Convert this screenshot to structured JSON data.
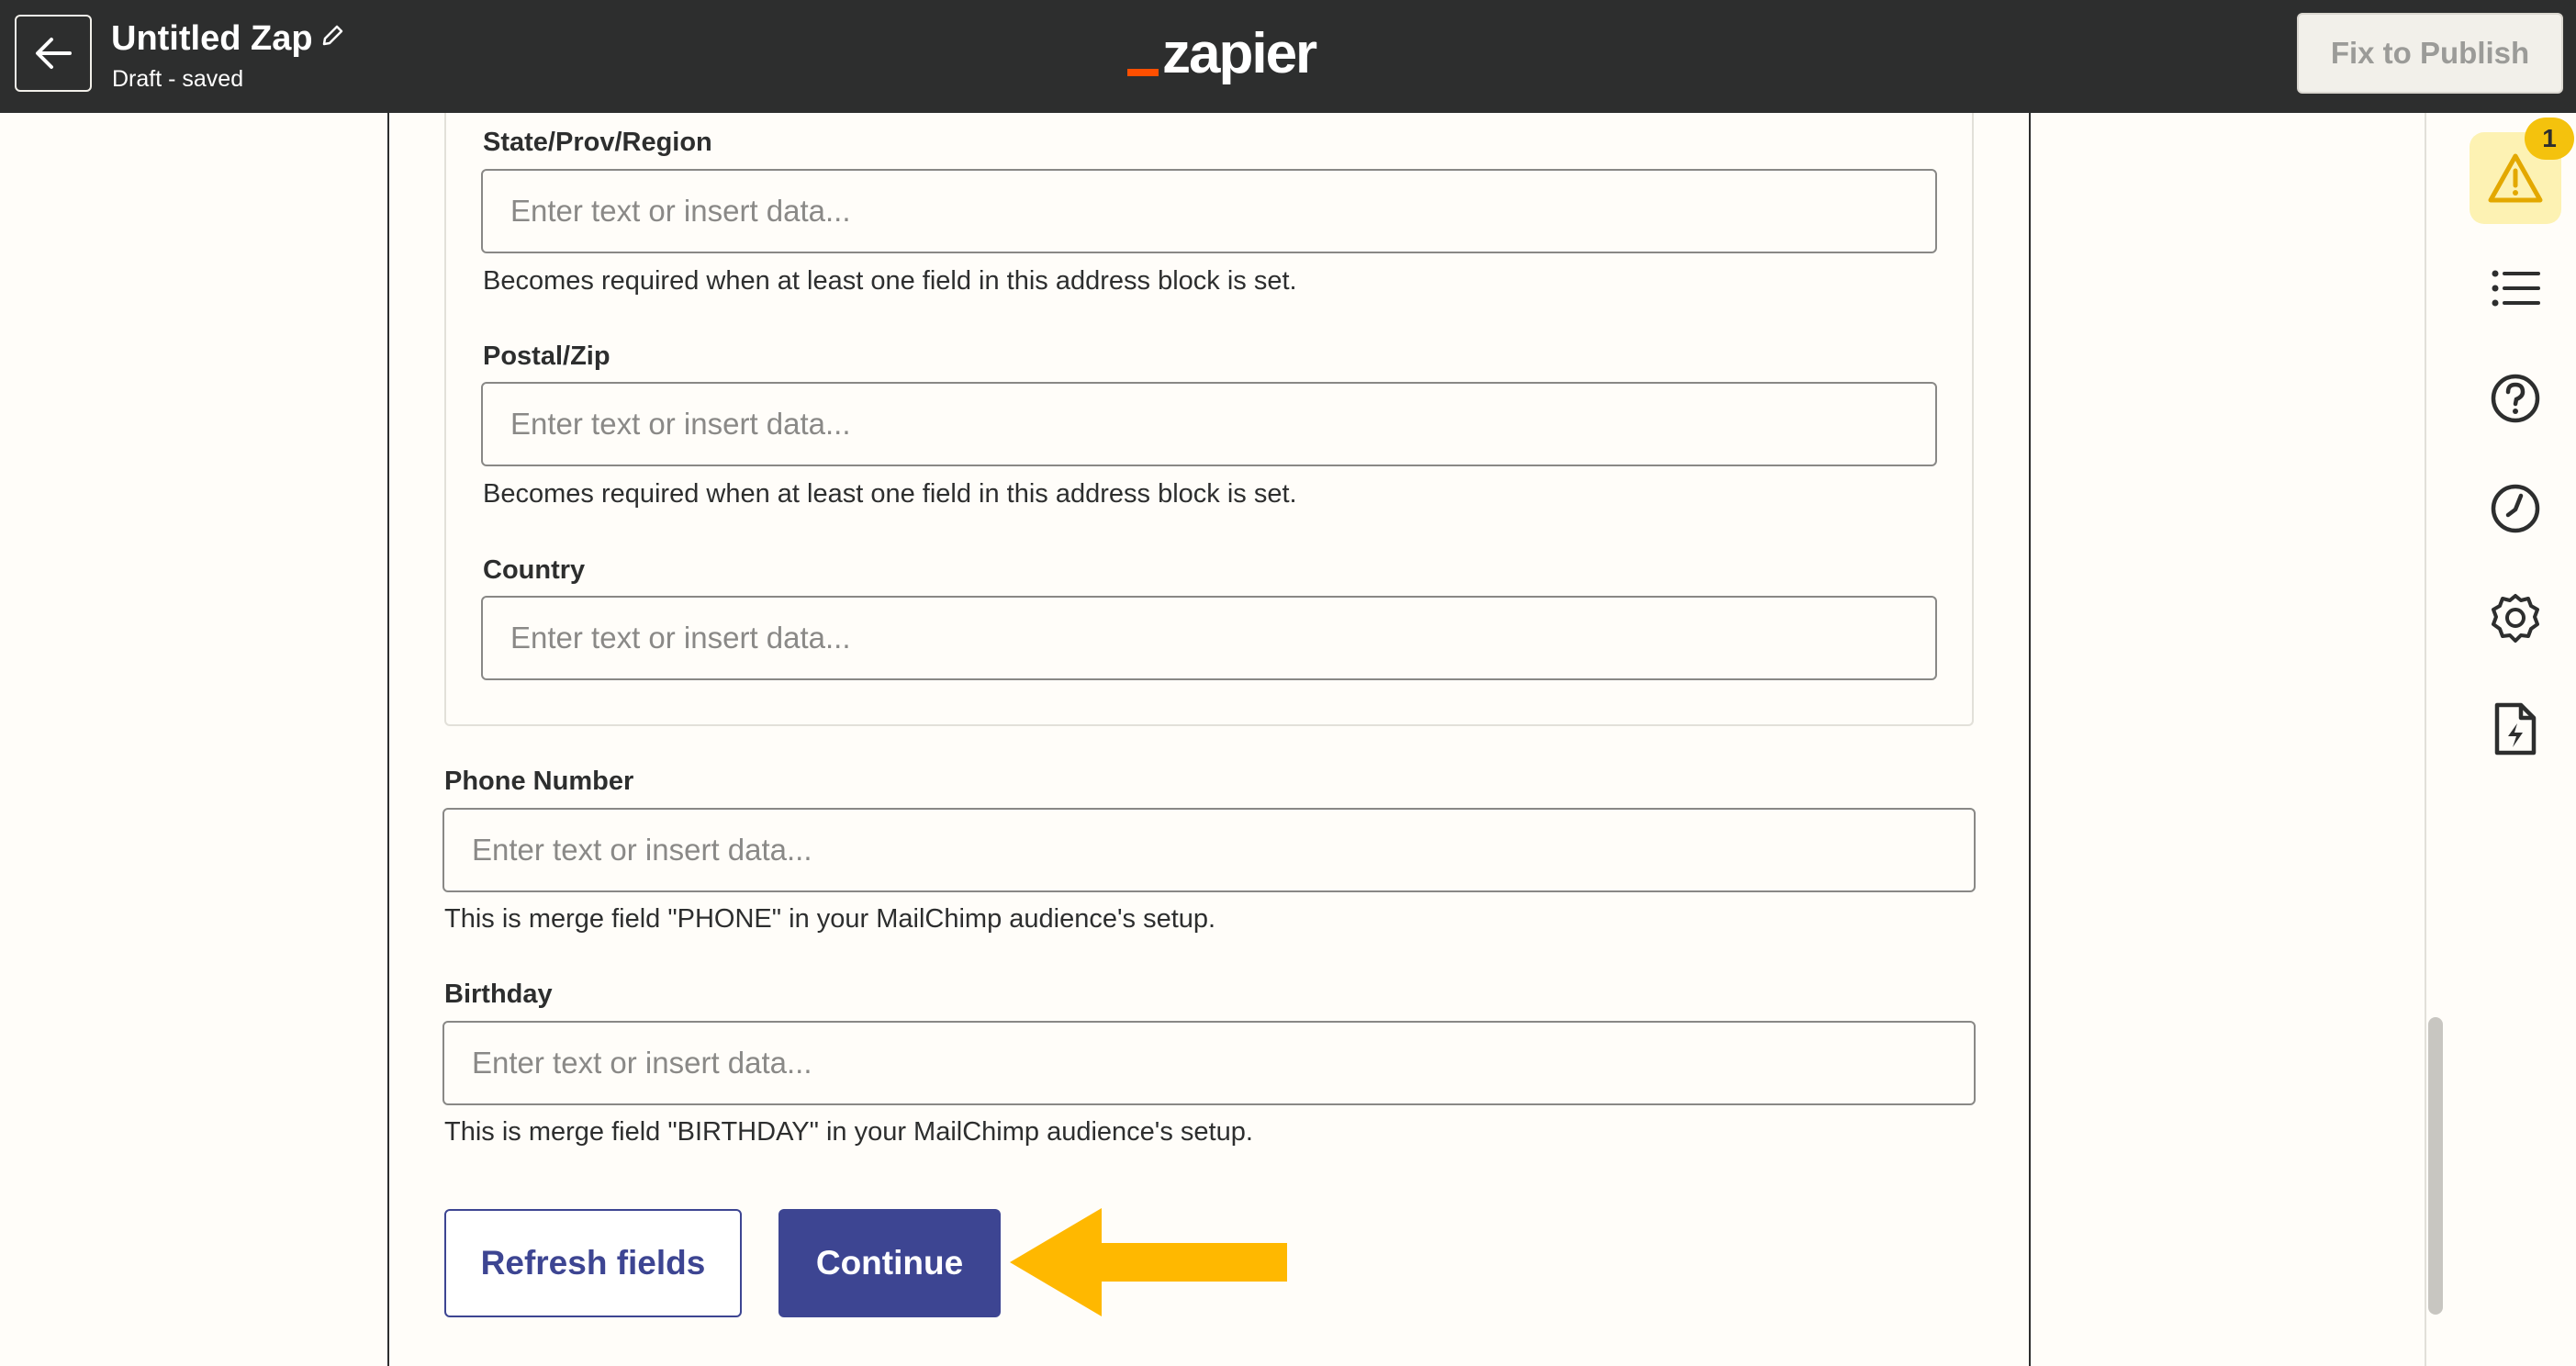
{
  "header": {
    "back_label": "Back",
    "zap_title": "Untitled Zap",
    "zap_status": "Draft - saved",
    "logo_text": "zapier",
    "publish_label": "Fix to Publish"
  },
  "address_block": {
    "fields": [
      {
        "label": "State/Prov/Region",
        "placeholder": "Enter text or insert data...",
        "help": "Becomes required when at least one field in this address block is set."
      },
      {
        "label": "Postal/Zip",
        "placeholder": "Enter text or insert data...",
        "help": "Becomes required when at least one field in this address block is set."
      },
      {
        "label": "Country",
        "placeholder": "Enter text or insert data..."
      }
    ]
  },
  "fields": [
    {
      "label": "Phone Number",
      "placeholder": "Enter text or insert data...",
      "help": "This is merge field \"PHONE\" in your MailChimp audience's setup."
    },
    {
      "label": "Birthday",
      "placeholder": "Enter text or insert data...",
      "help": "This is merge field \"BIRTHDAY\" in your MailChimp audience's setup."
    }
  ],
  "actions": {
    "refresh_label": "Refresh fields",
    "continue_label": "Continue"
  },
  "sidebar": {
    "alert_count": "1",
    "icons": [
      "warning-icon",
      "outline-icon",
      "help-icon",
      "history-icon",
      "settings-icon",
      "file-lightning-icon"
    ]
  },
  "colors": {
    "header_bg": "#2d2e2e",
    "brand_orange": "#ff4f00",
    "primary_button": "#3d4592",
    "annotation_arrow": "#ffb800",
    "alert_bg": "#fdf2b3",
    "badge": "#f4c20d"
  }
}
